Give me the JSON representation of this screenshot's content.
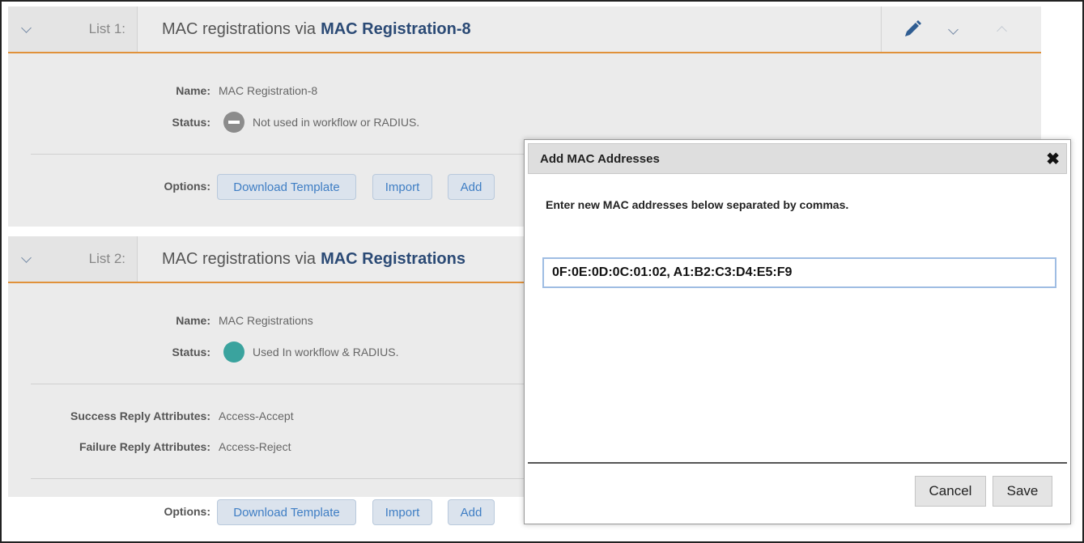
{
  "lists": [
    {
      "number_label": "List 1:",
      "title_prefix": "MAC registrations via",
      "title_name": "MAC Registration-8",
      "name_label": "Name:",
      "name_value": "MAC Registration-8",
      "status_label": "Status:",
      "status_value": "Not used in workflow or RADIUS.",
      "options_label": "Options:",
      "options": [
        "Download Template",
        "Import",
        "Add"
      ]
    },
    {
      "number_label": "List 2:",
      "title_prefix": "MAC registrations via",
      "title_name": "MAC Registrations",
      "name_label": "Name:",
      "name_value": "MAC Registrations",
      "status_label": "Status:",
      "status_value": "Used In workflow & RADIUS.",
      "success_label": "Success Reply Attributes:",
      "success_value": "Access-Accept",
      "failure_label": "Failure Reply Attributes:",
      "failure_value": "Access-Reject",
      "options_label": "Options:",
      "options": [
        "Download Template",
        "Import",
        "Add"
      ]
    }
  ],
  "modal": {
    "title": "Add MAC Addresses",
    "close_glyph": "✖",
    "instruction": "Enter new MAC addresses below separated by commas.",
    "input_value": "0F:0E:0D:0C:01:02, A1:B2:C3:D4:E5:F9",
    "cancel_label": "Cancel",
    "save_label": "Save"
  },
  "colors": {
    "accent_orange": "#e0913a",
    "title_blue": "#2b4a75",
    "status_unused": "#8c8c8c",
    "status_used": "#3aa39e",
    "link_blue": "#3f7ec4"
  }
}
